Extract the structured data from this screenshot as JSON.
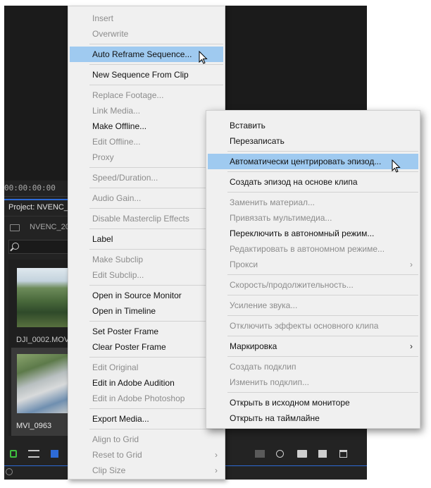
{
  "premiere": {
    "timecode": "00:00:00:00",
    "project_tab": "Project: NVENC_",
    "bin_name": "NVENC_20",
    "clips": [
      {
        "name": "DJI_0002.MOV"
      },
      {
        "name": "MVI_0963"
      }
    ],
    "accent_color": "#2e6bd6"
  },
  "menu_en": {
    "items": [
      {
        "label": "Insert",
        "enabled": false
      },
      {
        "label": "Overwrite",
        "enabled": false
      },
      {
        "sep": true
      },
      {
        "label": "Auto Reframe Sequence...",
        "enabled": true,
        "highlighted": true
      },
      {
        "sep": true
      },
      {
        "label": "New Sequence From Clip",
        "enabled": true
      },
      {
        "sep": true
      },
      {
        "label": "Replace Footage...",
        "enabled": false
      },
      {
        "label": "Link Media...",
        "enabled": false
      },
      {
        "label": "Make Offline...",
        "enabled": true
      },
      {
        "label": "Edit Offline...",
        "enabled": false
      },
      {
        "label": "Proxy",
        "enabled": false
      },
      {
        "sep": true
      },
      {
        "label": "Speed/Duration...",
        "enabled": false
      },
      {
        "sep": true
      },
      {
        "label": "Audio Gain...",
        "enabled": false
      },
      {
        "sep": true
      },
      {
        "label": "Disable Masterclip Effects",
        "enabled": false
      },
      {
        "sep": true
      },
      {
        "label": "Label",
        "enabled": true
      },
      {
        "sep": true
      },
      {
        "label": "Make Subclip",
        "enabled": false
      },
      {
        "label": "Edit Subclip...",
        "enabled": false
      },
      {
        "sep": true
      },
      {
        "label": "Open in Source Monitor",
        "enabled": true
      },
      {
        "label": "Open in Timeline",
        "enabled": true
      },
      {
        "sep": true
      },
      {
        "label": "Set Poster Frame",
        "enabled": true
      },
      {
        "label": "Clear Poster Frame",
        "enabled": true
      },
      {
        "sep": true
      },
      {
        "label": "Edit Original",
        "enabled": false
      },
      {
        "label": "Edit in Adobe Audition",
        "enabled": true
      },
      {
        "label": "Edit in Adobe Photoshop",
        "enabled": false
      },
      {
        "sep": true
      },
      {
        "label": "Export Media...",
        "enabled": true
      },
      {
        "sep": true
      },
      {
        "label": "Align to Grid",
        "enabled": false
      },
      {
        "label": "Reset to Grid",
        "enabled": false,
        "submenu": true
      },
      {
        "label": "Clip Size",
        "enabled": false,
        "submenu": true
      }
    ]
  },
  "menu_ru": {
    "items": [
      {
        "label": "Вставить",
        "enabled": true
      },
      {
        "label": "Перезаписать",
        "enabled": true
      },
      {
        "sep": true
      },
      {
        "label": "Автоматически центрировать эпизод...",
        "enabled": true,
        "highlighted": true
      },
      {
        "sep": true
      },
      {
        "label": "Создать эпизод на основе клипа",
        "enabled": true
      },
      {
        "sep": true
      },
      {
        "label": "Заменить материал...",
        "enabled": false
      },
      {
        "label": "Привязать мультимедиа...",
        "enabled": false
      },
      {
        "label": "Переключить в автономный режим...",
        "enabled": true
      },
      {
        "label": "Редактировать в автономном режиме...",
        "enabled": false
      },
      {
        "label": "Прокси",
        "enabled": false,
        "submenu": true
      },
      {
        "sep": true
      },
      {
        "label": "Скорость/продолжительность...",
        "enabled": false
      },
      {
        "sep": true
      },
      {
        "label": "Усиление звука...",
        "enabled": false
      },
      {
        "sep": true
      },
      {
        "label": "Отключить эффекты основного клипа",
        "enabled": false
      },
      {
        "sep": true
      },
      {
        "label": "Маркировка",
        "enabled": true,
        "submenu": true
      },
      {
        "sep": true
      },
      {
        "label": "Создать подклип",
        "enabled": false
      },
      {
        "label": "Изменить подклип...",
        "enabled": false
      },
      {
        "sep": true
      },
      {
        "label": "Открыть в исходном мониторе",
        "enabled": true
      },
      {
        "label": "Открыть на таймлайне",
        "enabled": true
      }
    ]
  },
  "submenu_arrow": "›"
}
